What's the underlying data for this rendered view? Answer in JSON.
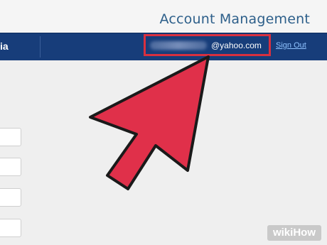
{
  "header": {
    "title": "Account Management"
  },
  "navbar": {
    "label": "ia",
    "email_domain": "@yahoo.com",
    "sign_out_label": "Sign Out"
  },
  "watermark": {
    "part1": "wiki",
    "part2": "How"
  },
  "colors": {
    "navbar": "#173d7a",
    "highlight": "#d8303f",
    "arrow": "#e0304a",
    "title": "#2d5f8a"
  },
  "icons": {
    "pointer": "arrow-pointer-icon"
  }
}
